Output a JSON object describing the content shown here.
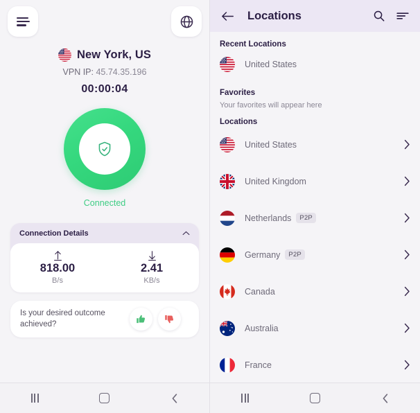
{
  "left": {
    "menu_icon": "hamburger-icon",
    "globe_icon": "globe-icon",
    "location_name": "New York, US",
    "location_flag": "us-flag",
    "vpn_ip_label": "VPN IP:",
    "vpn_ip_value": "45.74.35.196",
    "timer": "00:00:04",
    "status": "Connected",
    "status_icon": "shield-check-icon",
    "status_color": "#3ecd84",
    "ring_color": "#35d87e",
    "connection_details": {
      "title": "Connection Details",
      "collapse_icon": "chevron-up-icon",
      "upload": {
        "icon": "arrow-up-icon",
        "value": "818.00",
        "unit": "B/s"
      },
      "download": {
        "icon": "arrow-down-icon",
        "value": "2.41",
        "unit": "KB/s"
      }
    },
    "feedback": {
      "question": "Is your desired outcome achieved?",
      "thumbs_up_icon": "thumbs-up-icon",
      "thumbs_up_color": "#4bbf78",
      "thumbs_down_icon": "thumbs-down-icon",
      "thumbs_down_color": "#e8605e"
    }
  },
  "right": {
    "back_icon": "arrow-back-icon",
    "title": "Locations",
    "search_icon": "search-icon",
    "sort_icon": "sort-icon",
    "recent_section": {
      "title": "Recent Locations",
      "items": [
        {
          "label": "United States",
          "flag": "us-flag"
        }
      ]
    },
    "favorites_section": {
      "title": "Favorites",
      "empty_text": "Your favorites will appear here"
    },
    "locations_section": {
      "title": "Locations",
      "items": [
        {
          "label": "United States",
          "flag": "us-flag",
          "badge": ""
        },
        {
          "label": "United Kingdom",
          "flag": "uk-flag",
          "badge": ""
        },
        {
          "label": "Netherlands",
          "flag": "nl-flag",
          "badge": "P2P"
        },
        {
          "label": "Germany",
          "flag": "de-flag",
          "badge": "P2P"
        },
        {
          "label": "Canada",
          "flag": "ca-flag",
          "badge": ""
        },
        {
          "label": "Australia",
          "flag": "au-flag",
          "badge": ""
        },
        {
          "label": "France",
          "flag": "fr-flag",
          "badge": ""
        }
      ]
    }
  },
  "navbar": {
    "recents_icon": "recents-icon",
    "home_icon": "home-icon",
    "back_icon": "back-icon"
  }
}
